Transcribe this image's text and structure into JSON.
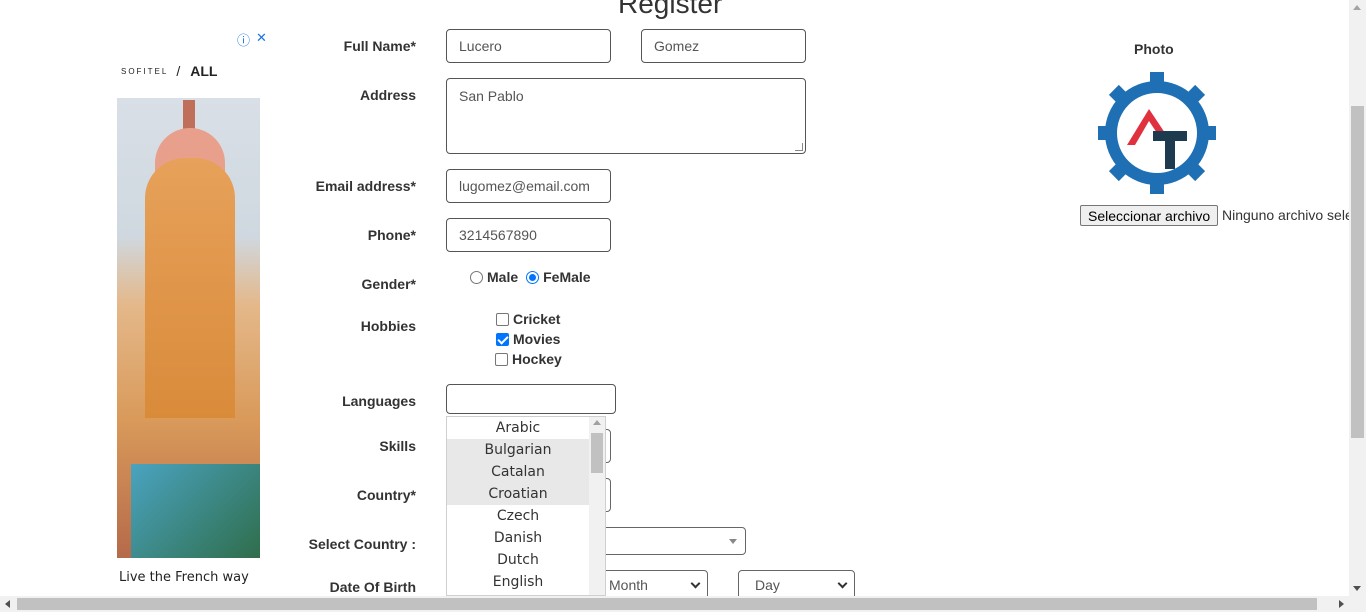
{
  "page": {
    "title": "Register"
  },
  "ad": {
    "brand": "SOFITEL",
    "partner": "ALL",
    "caption": "Live the French way"
  },
  "form": {
    "full_name": {
      "label": "Full Name*",
      "first": "Lucero",
      "last": "Gomez"
    },
    "address": {
      "label": "Address",
      "value": "San Pablo"
    },
    "email": {
      "label": "Email address*",
      "value": "lugomez@email.com"
    },
    "phone": {
      "label": "Phone*",
      "value": "3214567890"
    },
    "gender": {
      "label": "Gender*",
      "options": [
        "Male",
        "FeMale"
      ],
      "selected": "FeMale"
    },
    "hobbies": {
      "label": "Hobbies",
      "items": [
        {
          "label": "Cricket",
          "checked": false
        },
        {
          "label": "Movies",
          "checked": true
        },
        {
          "label": "Hockey",
          "checked": false
        }
      ]
    },
    "languages": {
      "label": "Languages",
      "value": "",
      "options": [
        "Arabic",
        "Bulgarian",
        "Catalan",
        "Croatian",
        "Czech",
        "Danish",
        "Dutch",
        "English"
      ]
    },
    "skills": {
      "label": "Skills"
    },
    "country": {
      "label": "Country*"
    },
    "select_country": {
      "label": "Select Country :"
    },
    "dob": {
      "label": "Date Of Birth",
      "month": "Month",
      "day": "Day"
    }
  },
  "photo": {
    "label": "Photo",
    "button": "Seleccionar archivo",
    "status": "Ninguno archivo seleccionado"
  },
  "colors": {
    "accent": "#0075ff",
    "logo_blue": "#1f6fb5",
    "logo_red": "#e0313f",
    "logo_dark": "#1e3a4f"
  }
}
